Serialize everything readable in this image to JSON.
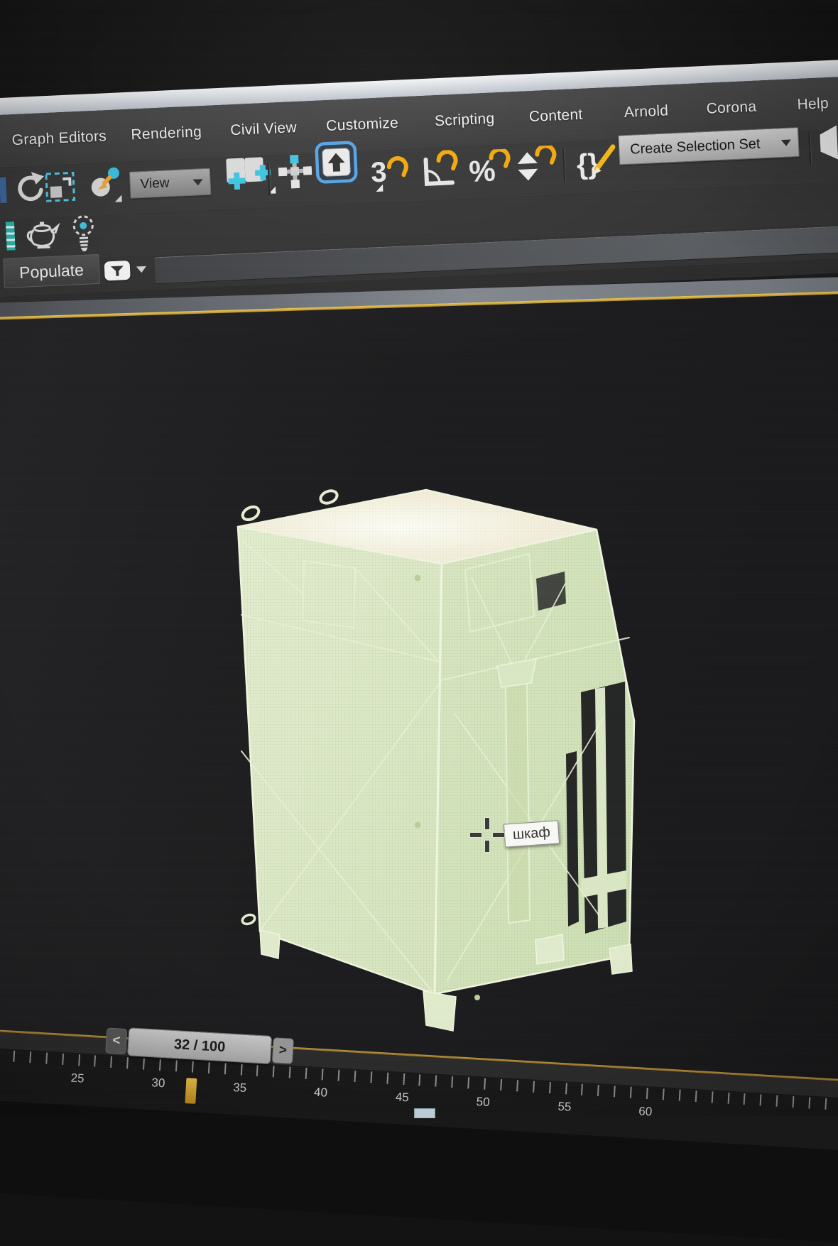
{
  "menubar": {
    "items": [
      {
        "label": "Graph Editors"
      },
      {
        "label": "Rendering"
      },
      {
        "label": "Civil View"
      },
      {
        "label": "Customize"
      },
      {
        "label": "Scripting"
      },
      {
        "label": "Content"
      },
      {
        "label": "Arnold"
      },
      {
        "label": "Corona"
      },
      {
        "label": "Help"
      }
    ]
  },
  "toolbar_main": {
    "reference_coordinate_system": {
      "value": "View"
    },
    "create_selection_set_label": "Create Selection Set",
    "snap_3d_glyph": "3",
    "named_sets_glyph": "{}",
    "icons": [
      "redo",
      "rectangular-selection-region",
      "select-and-manipulate",
      "add-page-a",
      "add-page-b",
      "snaps-cross",
      "keyboard-shortcut-override-active",
      "snap-3d",
      "angle-snap",
      "percent-snap",
      "spinner-snap",
      "edit-named-selection-sets",
      "mirror-partial"
    ]
  },
  "toolbar_secondary": {
    "icons": [
      "render-teapot",
      "default-lights-bulb"
    ]
  },
  "populate_bar": {
    "tab_label": "Populate",
    "icons": [
      "filter-funnel",
      "dropdown-arrow"
    ]
  },
  "viewport": {
    "tooltip_text": "шкаф",
    "model_description": "dense pale-green wireframe cabinet with lifting loops, open right-side frame and corner feet",
    "border_color_active": "#d9b44a",
    "background_color": "#1e1e20",
    "wireframe_color": "#dce9c8"
  },
  "timeline": {
    "frame_display": "32 / 100",
    "current_frame": 32,
    "total_frames": 100,
    "prev_button": "<",
    "next_button": ">",
    "ruler_labels": [
      "25",
      "30",
      "35",
      "40",
      "45",
      "50",
      "55",
      "60"
    ],
    "marker_color": "#d9a832"
  },
  "colors": {
    "accent_cyan": "#3ec2de",
    "accent_yellow": "#f0a80a",
    "kbd_active_blue": "#55a2e2",
    "chrome_bg": "#3a3a3a",
    "menu_text": "#ededed"
  }
}
